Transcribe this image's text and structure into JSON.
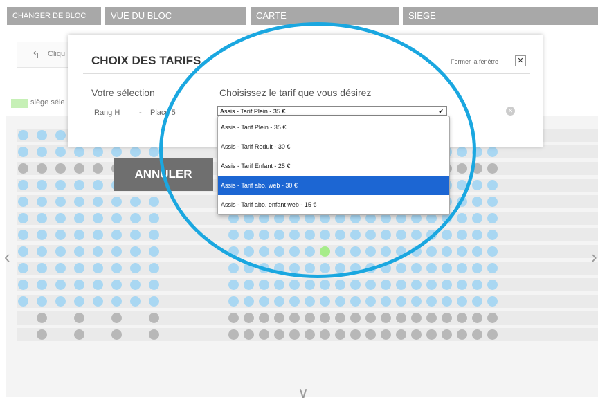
{
  "tabs": [
    "CHANGER DE BLOC",
    "VUE DU BLOC",
    "CARTE",
    "SIEGE"
  ],
  "back": {
    "label": "Cliqu",
    "icon": "back-arrow-icon"
  },
  "legend": {
    "label": "siège séle",
    "color": "#c6f0b6"
  },
  "seat_map": {
    "rows": [
      "aaaaaaaau.....aaaaaaaaaaaaaaaaaaaaaaaaaaaaaaa",
      "aaaaaaaaa.....aaaaaaaaaaaaaaaaaaaaaaaaaaaaaaa",
      "uuuuuuuuu.....aaaaaaaaaaaaaaaaaaaaaaaaaaaaaaa"
    ],
    "legend_colors": {
      "available": "#a9d7f2",
      "unavailable": "#b8b8b8",
      "selected": "#a6ec8a"
    }
  },
  "annuler_label": "ANNULER",
  "modal": {
    "title": "CHOIX DES TARIFS",
    "close_label": "Fermer la fenêtre",
    "close_icon": "close-icon",
    "selection_label": "Votre sélection",
    "rang": "Rang H",
    "dash": "-",
    "place": "Place 5",
    "choose_label": "Choisissez le tarif que vous désirez",
    "selected_value": "Assis - Tarif Plein - 35 €",
    "clear_icon": "clear-icon"
  },
  "dropdown": {
    "options": [
      "Assis - Tarif Plein - 35 €",
      "Assis - Tarif Reduit - 30 €",
      "Assis - Tarif Enfant - 25 €",
      "Assis - Tarif abo. web - 30 €",
      "Assis - Tarif abo. enfant web - 15 €"
    ],
    "highlighted_index": 3
  },
  "annotation": {
    "shape": "circle",
    "color": "#1aa7e0"
  }
}
